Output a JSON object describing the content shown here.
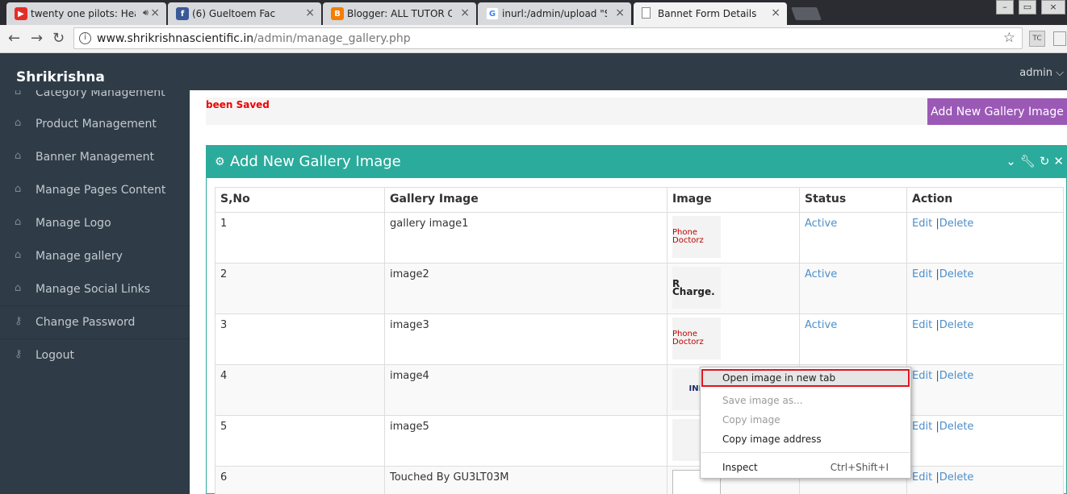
{
  "browser": {
    "tabs": [
      {
        "title": "twenty one pilots: Hea",
        "favicon": "youtube-icon",
        "color": "#e52d27"
      },
      {
        "title": "(6) Gueltoem Fac",
        "favicon": "facebook-icon",
        "color": "#3b5998"
      },
      {
        "title": "Blogger: ALL TUTOR CYB",
        "favicon": "blogger-icon",
        "color": "#f57d00"
      },
      {
        "title": "inurl:/admin/upload \"SCI",
        "favicon": "google-icon",
        "color": "#4285f4"
      },
      {
        "title": "Bannet Form Details",
        "favicon": "page-icon",
        "color": "#888888",
        "active": true
      }
    ],
    "address": {
      "domain": "www.shrikrishnascientific.in",
      "path": "/admin/manage_gallery.php"
    }
  },
  "header": {
    "brand": "Shrikrishna",
    "user": "admin ⌵"
  },
  "sidebar": {
    "items": [
      {
        "label": "Category Management",
        "icon": "home-icon"
      },
      {
        "label": "Product Management",
        "icon": "home-icon"
      },
      {
        "label": "Banner Management",
        "icon": "home-icon"
      },
      {
        "label": "Manage Pages Content",
        "icon": "home-icon"
      },
      {
        "label": "Manage Logo",
        "icon": "home-icon"
      },
      {
        "label": "Manage gallery",
        "icon": "home-icon"
      },
      {
        "label": "Manage Social Links",
        "icon": "home-icon"
      },
      {
        "label": "Change Password",
        "icon": "key-icon"
      },
      {
        "label": "Logout",
        "icon": "key-icon"
      }
    ]
  },
  "main": {
    "message": "been Saved",
    "add_button": "Add New Gallery Image",
    "panel_title": "Add New Gallery Image",
    "columns": [
      "S,No",
      "Gallery Image",
      "Image",
      "Status",
      "Action"
    ],
    "rows": [
      {
        "sno": "1",
        "name": "gallery image1",
        "thumb": "Phone Doctorz",
        "status": "Active"
      },
      {
        "sno": "2",
        "name": "image2",
        "thumb": "R Charge.",
        "status": "Active"
      },
      {
        "sno": "3",
        "name": "image3",
        "thumb": "Phone Doctorz",
        "status": "Active"
      },
      {
        "sno": "4",
        "name": "image4",
        "thumb": "INF",
        "status": ""
      },
      {
        "sno": "5",
        "name": "image5",
        "thumb": "",
        "status": ""
      },
      {
        "sno": "6",
        "name": "Touched By GU3LT03M",
        "thumb": "",
        "status": ""
      }
    ],
    "edit_label": "Edit",
    "pipe": "|",
    "delete_label": "Delete"
  },
  "context_menu": {
    "items": [
      {
        "label": "Open image in new tab",
        "disabled": false,
        "highlighted": true
      },
      {
        "label": "Save image as...",
        "disabled": true
      },
      {
        "label": "Copy image",
        "disabled": true
      },
      {
        "label": "Copy image address",
        "disabled": false
      },
      {
        "label": "Inspect",
        "shortcut": "Ctrl+Shift+I",
        "disabled": false
      }
    ]
  }
}
